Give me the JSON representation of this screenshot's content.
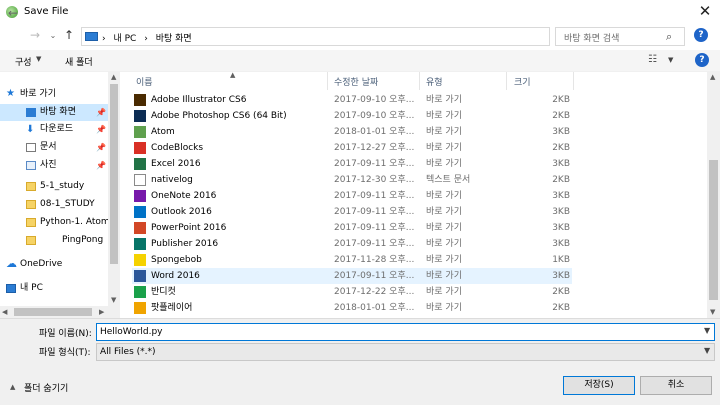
{
  "window": {
    "title": "Save File",
    "close_glyph": "✕"
  },
  "nav": {
    "back": "←",
    "forward": "→",
    "dropdown": "⌄",
    "up": "↑",
    "breadcrumbs": [
      "›",
      "내 PC",
      "›",
      "바탕 화면"
    ],
    "address_dropdown": "⌄",
    "refresh": "↻",
    "search_placeholder": "바탕 화면 검색",
    "search_icon": "⌕"
  },
  "toolbar": {
    "organize_label": "구성",
    "newfolder_label": "새 폴더",
    "view_glyph": "☷",
    "help_glyph": "?"
  },
  "sidebar": {
    "items": [
      {
        "label": "바로 가기",
        "icon": "star-icon",
        "pinned": false
      },
      {
        "label": "바탕 화면",
        "icon": "desktop-icon",
        "pinned": true,
        "selected": true
      },
      {
        "label": "다운로드",
        "icon": "download-icon",
        "pinned": true
      },
      {
        "label": "문서",
        "icon": "document-icon",
        "pinned": true
      },
      {
        "label": "사진",
        "icon": "picture-icon",
        "pinned": true
      },
      {
        "label": "5-1_study",
        "icon": "folder-icon",
        "pinned": false
      },
      {
        "label": "08-1_STUDY",
        "icon": "folder-icon",
        "pinned": false
      },
      {
        "label": "Python-1. Atom",
        "icon": "folder-icon",
        "pinned": false
      },
      {
        "label": "PingPong",
        "icon": "folder-icon",
        "pinned": false
      },
      {
        "label": "OneDrive",
        "icon": "cloud-icon",
        "pinned": false
      },
      {
        "label": "내 PC",
        "icon": "computer-icon",
        "pinned": false
      }
    ]
  },
  "columns": {
    "name": "이름",
    "date": "수정한 날짜",
    "type": "유형",
    "size": "크기"
  },
  "files": [
    {
      "name": "Adobe Illustrator CS6",
      "date": "2017-09-10 오후...",
      "type": "바로 가기",
      "size": "2KB",
      "icon_color": "#4a2a00"
    },
    {
      "name": "Adobe Photoshop CS6 (64 Bit)",
      "date": "2017-09-10 오후...",
      "type": "바로 가기",
      "size": "2KB",
      "icon_color": "#0c2c54"
    },
    {
      "name": "Atom",
      "date": "2018-01-01 오후...",
      "type": "바로 가기",
      "size": "3KB",
      "icon_color": "#5fa04e"
    },
    {
      "name": "CodeBlocks",
      "date": "2017-12-27 오후...",
      "type": "바로 가기",
      "size": "2KB",
      "icon_color": "#d93025"
    },
    {
      "name": "Excel 2016",
      "date": "2017-09-11 오후...",
      "type": "바로 가기",
      "size": "3KB",
      "icon_color": "#217346"
    },
    {
      "name": "nativelog",
      "date": "2017-12-30 오후...",
      "type": "텍스트 문서",
      "size": "2KB",
      "icon_color": "#ffffff"
    },
    {
      "name": "OneNote 2016",
      "date": "2017-09-11 오후...",
      "type": "바로 가기",
      "size": "3KB",
      "icon_color": "#7719aa"
    },
    {
      "name": "Outlook 2016",
      "date": "2017-09-11 오후...",
      "type": "바로 가기",
      "size": "3KB",
      "icon_color": "#0072c6"
    },
    {
      "name": "PowerPoint 2016",
      "date": "2017-09-11 오후...",
      "type": "바로 가기",
      "size": "3KB",
      "icon_color": "#d24726"
    },
    {
      "name": "Publisher 2016",
      "date": "2017-09-11 오후...",
      "type": "바로 가기",
      "size": "3KB",
      "icon_color": "#077568"
    },
    {
      "name": "Spongebob",
      "date": "2017-11-28 오후...",
      "type": "바로 가기",
      "size": "1KB",
      "icon_color": "#f5d200"
    },
    {
      "name": "Word 2016",
      "date": "2017-09-11 오후...",
      "type": "바로 가기",
      "size": "3KB",
      "icon_color": "#2b579a",
      "selected": true
    },
    {
      "name": "반디컷",
      "date": "2017-12-22 오후...",
      "type": "바로 가기",
      "size": "2KB",
      "icon_color": "#1aa14a"
    },
    {
      "name": "팟플레이어",
      "date": "2018-01-01 오후...",
      "type": "바로 가기",
      "size": "2KB",
      "icon_color": "#f0a400"
    }
  ],
  "bottom": {
    "filename_label": "파일 이름(N):",
    "filename_value": "HelloWorld.py",
    "filetype_label": "파일 형식(T):",
    "filetype_value": "All Files (*.*)",
    "hide_folders_glyph": "▲",
    "hide_folders_label": "폴더 숨기기",
    "save_label": "저장(S)",
    "cancel_label": "취소"
  }
}
